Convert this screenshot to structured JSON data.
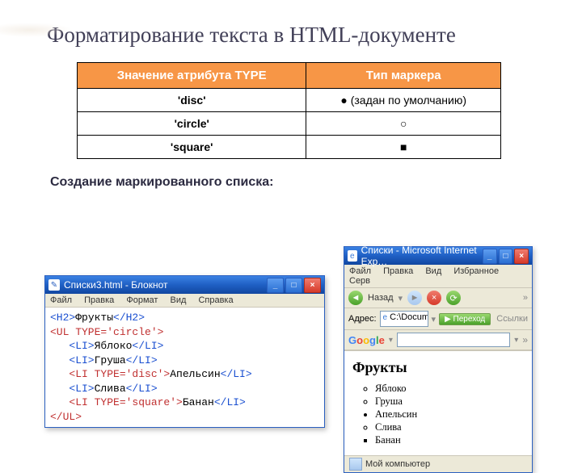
{
  "slide": {
    "title": "Форматирование текста в HTML-документе",
    "subheading": "Создание маркированного списка:"
  },
  "table": {
    "headers": [
      "Значение атрибута TYPE",
      "Тип маркера"
    ],
    "rows": [
      [
        "'disc'",
        "● (задан по умолчанию)"
      ],
      [
        "'circle'",
        "○"
      ],
      [
        "'square'",
        "■"
      ]
    ]
  },
  "notepad": {
    "title": "Списки3.html - Блокнот",
    "menu": [
      "Файл",
      "Правка",
      "Формат",
      "Вид",
      "Справка"
    ],
    "code": {
      "l1a": "<H2>",
      "l1b": "Фрукты",
      "l1c": "</H2>",
      "l2": "<UL TYPE='circle'>",
      "l3a": "   <LI>",
      "l3b": "Яблоко",
      "l3c": "</LI>",
      "l4a": "   <LI>",
      "l4b": "Груша",
      "l4c": "</LI>",
      "l5a": "   <LI TYPE='disc'>",
      "l5b": "Апельсин",
      "l5c": "</LI>",
      "l6a": "   <LI>",
      "l6b": "Слива",
      "l6c": "</LI>",
      "l7a": "   <LI TYPE='square'>",
      "l7b": "Банан",
      "l7c": "</LI>",
      "l8": "</UL>"
    }
  },
  "ie": {
    "title": "Списки - Microsoft Internet Exp…",
    "menu": [
      "Файл",
      "Правка",
      "Вид",
      "Избранное",
      "Серв"
    ],
    "back_label": "Назад",
    "addr_label": "Адрес:",
    "addr_value": "C:\\Documen",
    "go_label": "Переход",
    "links_label": "Ссылки",
    "page_heading": "Фрукты",
    "items": [
      {
        "text": "Яблоко",
        "style": "circle"
      },
      {
        "text": "Груша",
        "style": "circle"
      },
      {
        "text": "Апельсин",
        "style": "disc"
      },
      {
        "text": "Слива",
        "style": "circle"
      },
      {
        "text": "Банан",
        "style": "square"
      }
    ],
    "status": "Мой компьютер"
  }
}
